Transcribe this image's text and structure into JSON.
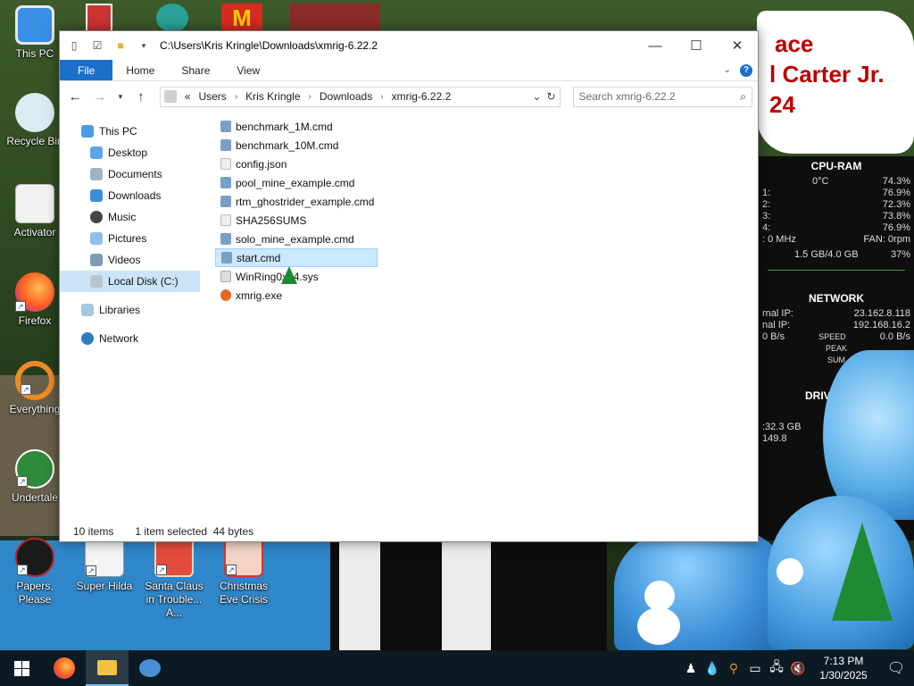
{
  "desktop": {
    "banner_lines": [
      "ace",
      "l Carter Jr.",
      "24"
    ],
    "icons": [
      {
        "label": "This PC",
        "icon": "this-pc-icon"
      },
      {
        "label": "Recycle Bin",
        "icon": "recycle-bin-icon"
      },
      {
        "label": "Activator",
        "icon": "activator-icon"
      },
      {
        "label": "Firefox",
        "icon": "firefox-icon"
      },
      {
        "label": "Everything",
        "icon": "everything-icon"
      },
      {
        "label": "Undertale",
        "icon": "undertale-icon"
      },
      {
        "label": "Papers, Please",
        "icon": "papers-please-icon"
      },
      {
        "label": "Super Hilda",
        "icon": "super-hilda-icon"
      },
      {
        "label": "Santa Claus in Trouble... A...",
        "icon": "santa-claus-icon"
      },
      {
        "label": "Christmas Eve Crisis",
        "icon": "christmas-eve-crisis-icon"
      }
    ]
  },
  "explorer": {
    "title": "C:\\Users\\Kris Kringle\\Downloads\\xmrig-6.22.2",
    "ribbon_tabs": [
      "File",
      "Home",
      "Share",
      "View"
    ],
    "address": {
      "prefix": "«",
      "crumbs": [
        "Users",
        "Kris Kringle",
        "Downloads",
        "xmrig-6.22.2"
      ]
    },
    "search_placeholder": "Search xmrig-6.22.2",
    "nav_pane": [
      {
        "label": "This PC",
        "icon": "this-pc-icon",
        "level": 0
      },
      {
        "label": "Desktop",
        "icon": "desktop-folder-icon",
        "level": 1
      },
      {
        "label": "Documents",
        "icon": "documents-folder-icon",
        "level": 1
      },
      {
        "label": "Downloads",
        "icon": "downloads-folder-icon",
        "level": 1
      },
      {
        "label": "Music",
        "icon": "music-folder-icon",
        "level": 1
      },
      {
        "label": "Pictures",
        "icon": "pictures-folder-icon",
        "level": 1
      },
      {
        "label": "Videos",
        "icon": "videos-folder-icon",
        "level": 1
      },
      {
        "label": "Local Disk (C:)",
        "icon": "local-disk-icon",
        "level": 1,
        "selected": true
      },
      {
        "label": "Libraries",
        "icon": "libraries-icon",
        "level": 0,
        "gap": true
      },
      {
        "label": "Network",
        "icon": "network-icon",
        "level": 0,
        "gap": true
      }
    ],
    "files": [
      {
        "name": "benchmark_1M.cmd",
        "type": "cmd"
      },
      {
        "name": "benchmark_10M.cmd",
        "type": "cmd"
      },
      {
        "name": "config.json",
        "type": "json"
      },
      {
        "name": "pool_mine_example.cmd",
        "type": "cmd"
      },
      {
        "name": "rtm_ghostrider_example.cmd",
        "type": "cmd"
      },
      {
        "name": "SHA256SUMS",
        "type": "file"
      },
      {
        "name": "solo_mine_example.cmd",
        "type": "cmd"
      },
      {
        "name": "start.cmd",
        "type": "cmd",
        "selected": true
      },
      {
        "name": "WinRing0x64.sys",
        "type": "sys"
      },
      {
        "name": "xmrig.exe",
        "type": "exe"
      }
    ],
    "status": {
      "items": "10 items",
      "selected": "1 item selected",
      "size": "44 bytes"
    }
  },
  "widgets": {
    "cpu_ram": {
      "title": "CPU-RAM",
      "temp": "0°C",
      "total": "74.3%",
      "cores": [
        {
          "label": "1:",
          "value": "76.9%"
        },
        {
          "label": "2:",
          "value": "72.3%"
        },
        {
          "label": "3:",
          "value": "73.8%"
        },
        {
          "label": "4:",
          "value": "76.9%"
        }
      ],
      "freq": ": 0 MHz",
      "fan": "FAN: 0rpm",
      "ram": "1.5 GB/4.0 GB",
      "ram_pct": "37%"
    },
    "network": {
      "title": "NETWORK",
      "external_label": "rnal IP:",
      "external_ip": "23.162.8.118",
      "internal_label": "nal IP:",
      "internal_ip": "192.168.16.2",
      "speed_left": "0 B/s",
      "speed_label": "SPEED",
      "speed_right": "0.0 B/s",
      "peak_label": "PEAK",
      "sum_label": "SUM"
    },
    "drive": {
      "title": "DRIV",
      "size": ":32.3 GB",
      "pct": "149.8"
    }
  },
  "taskbar": {
    "apps": [
      "start-icon",
      "firefox-icon",
      "file-explorer-icon",
      "people-icon"
    ],
    "clock_time": "7:13 PM",
    "clock_date": "1/30/2025"
  },
  "colors": {
    "accent": "#1a6fc9",
    "selection": "#cce8ff",
    "taskbar": "#0c1a24"
  }
}
